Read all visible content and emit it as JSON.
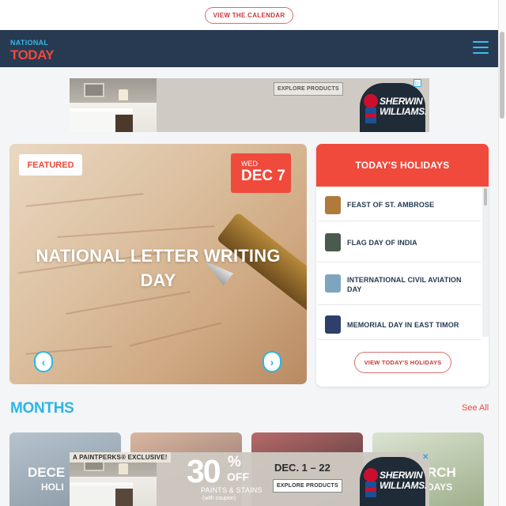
{
  "top_bar": {
    "calendar_button": "VIEW THE CALENDAR"
  },
  "header": {
    "logo_line1": "NATIONAL",
    "logo_line2": "TODAY"
  },
  "ad_top": {
    "explore_button": "EXPLORE PRODUCTS",
    "brand_line1": "SHERWIN",
    "brand_line2": "WILLIAMS."
  },
  "featured": {
    "badge": "FEATURED",
    "day_of_week": "WED",
    "date": "DEC 7",
    "title": "NATIONAL LETTER WRITING DAY",
    "prev_arrow": "‹",
    "next_arrow": "›"
  },
  "holidays": {
    "heading": "TODAY'S HOLIDAYS",
    "items": [
      {
        "name": "FEAST OF ST. AMBROSE",
        "thumb_color": "#b07a3a"
      },
      {
        "name": "FLAG DAY OF INDIA",
        "thumb_color": "#4a5a4e"
      },
      {
        "name": "INTERNATIONAL CIVIL AVIATION DAY",
        "thumb_color": "#7fa4bf"
      },
      {
        "name": "MEMORIAL DAY IN EAST TIMOR",
        "thumb_color": "#2d3f6a"
      }
    ],
    "button": "VIEW TODAY'S HOLIDAYS"
  },
  "months": {
    "title": "MONTHS",
    "see_all": "See All",
    "cards": [
      {
        "label1": "DECE",
        "label2": "HOLI",
        "color_a": "#b6c3cd",
        "color_b": "#8a99a6"
      },
      {
        "label1": "",
        "label2": "",
        "color_a": "#d9b7a0",
        "color_b": "#8c6b68"
      },
      {
        "label1": "",
        "label2": "",
        "color_a": "#b86a6a",
        "color_b": "#3e2f33"
      },
      {
        "label1": "RCH",
        "label2": "DAYS",
        "color_a": "#dbe3d1",
        "color_b": "#9fb08c"
      }
    ]
  },
  "ad_bottom": {
    "paintperks": "A PAINTPERKS® EXCLUSIVE!",
    "percent": "30",
    "percent_sign": "%",
    "off": "OFF",
    "paints": "PAINTS & STAINS",
    "coupon": "(with coupon)",
    "dates": "DEC. 1 – 22",
    "explore_button": "EXPLORE PRODUCTS",
    "brand_line1": "SHERWIN",
    "brand_line2": "WILLIAMS.",
    "close": "✕"
  },
  "colors": {
    "accent_red": "#ef4a3c",
    "accent_blue": "#2cb6e5",
    "navy": "#273a52"
  }
}
